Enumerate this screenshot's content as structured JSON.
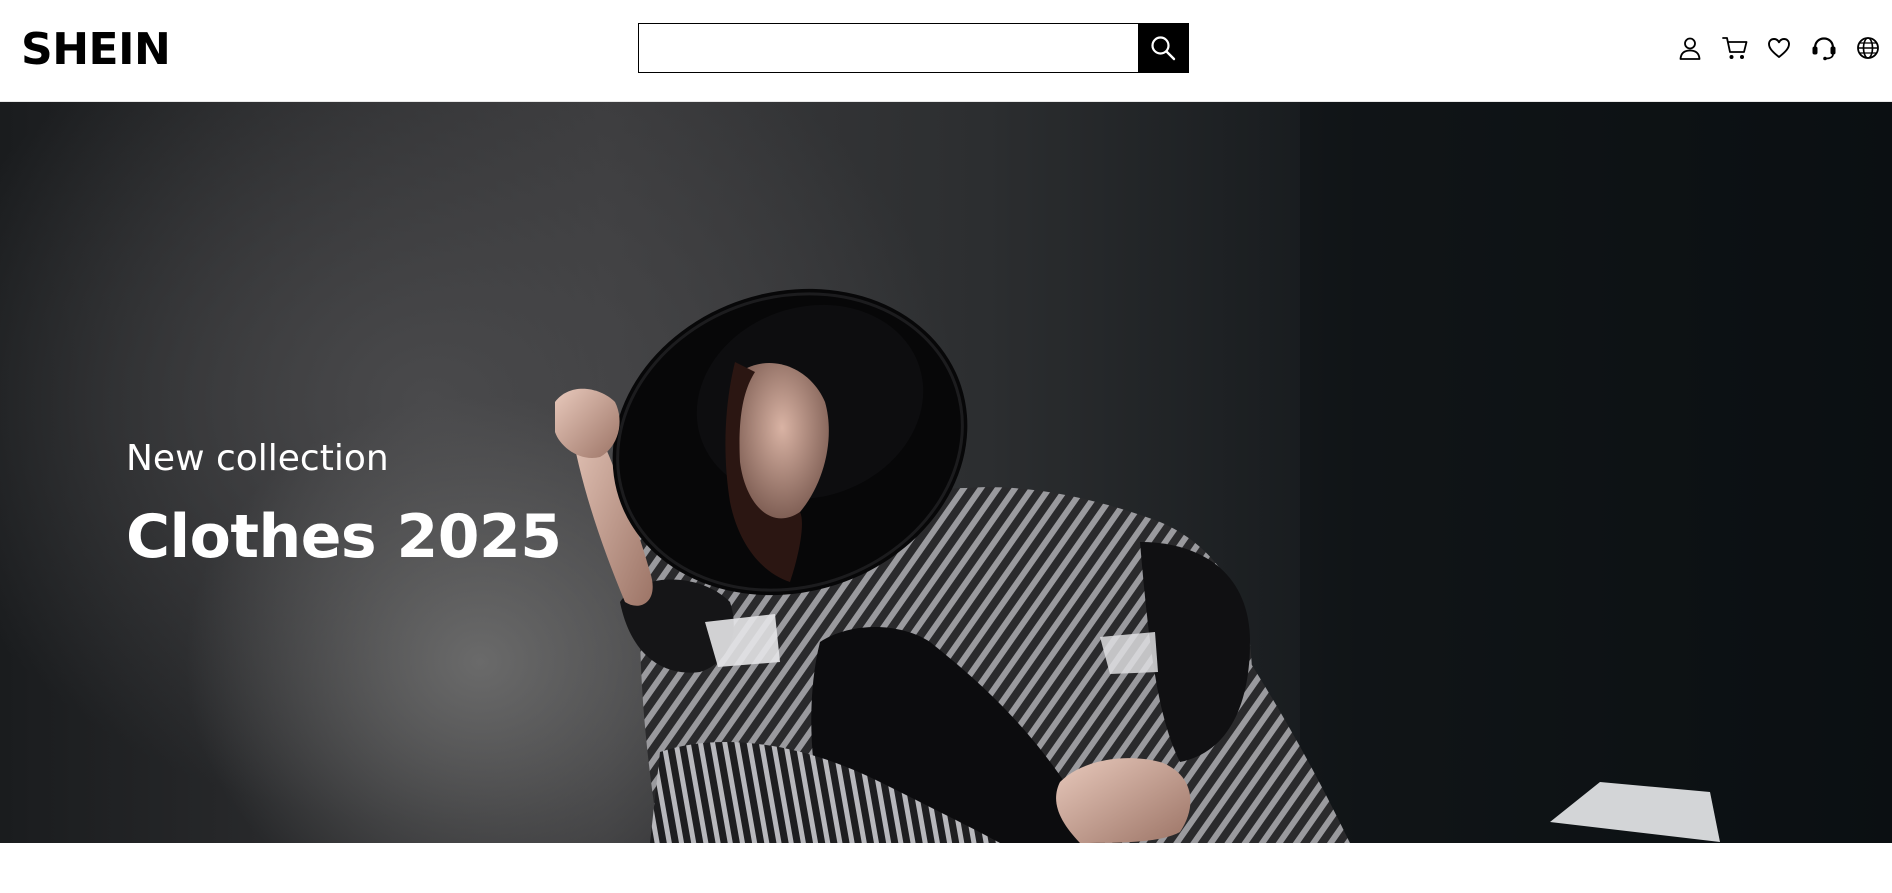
{
  "header": {
    "logo": "SHEIN",
    "search": {
      "value": "",
      "placeholder": ""
    },
    "search_button_icon": "search-icon",
    "icons": [
      "user-icon",
      "cart-icon",
      "heart-icon",
      "support-icon",
      "globe-icon"
    ]
  },
  "hero": {
    "subtitle": "New collection",
    "title": "Clothes 2025"
  },
  "colors": {
    "brand": "#000000",
    "background": "#ffffff",
    "hero_text": "#ffffff"
  }
}
